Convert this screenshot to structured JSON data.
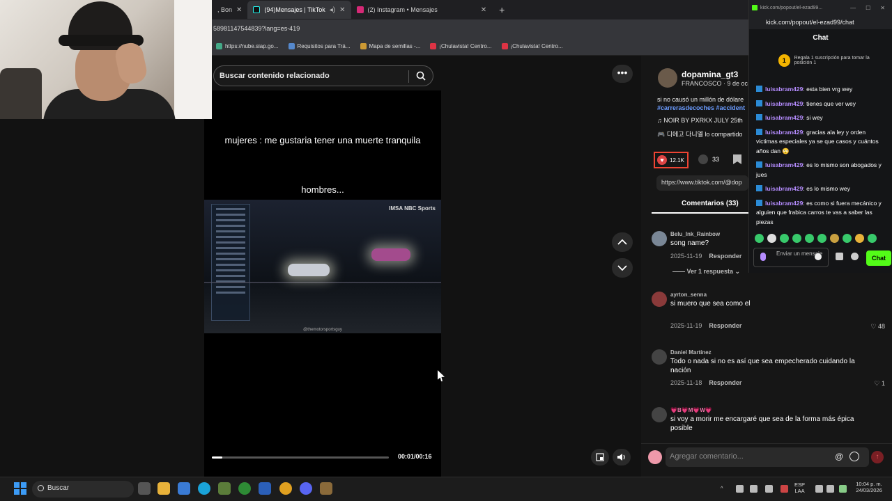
{
  "browser": {
    "tabs": [
      {
        "label": ", Bon",
        "icon": "tab-icon"
      },
      {
        "label": "(94)Mensajes | TikTok",
        "icon": "tiktok-icon"
      },
      {
        "label": "(2) Instagram • Mensajes",
        "icon": "instagram-icon"
      }
    ],
    "url": "58981147544839?lang=es-419",
    "bookmarks": [
      "https://nube.siap.go...",
      "Requisitos para Trá...",
      "Mapa de semillas -...",
      "¡Chulavista! Centro...",
      "¡Chulavista! Centro..."
    ]
  },
  "search": {
    "placeholder": "Buscar contenido relacionado"
  },
  "video": {
    "caption_top": "mujeres : me gustaria tener una muerte tranquila",
    "caption_mid": "hombres...",
    "clip_logo": "IMSA  NBC Sports",
    "clip_watermark": "@themotorsportsguy",
    "time": "00:01/00:16",
    "progress": 0.03
  },
  "post": {
    "author": "dopamina_gt3",
    "author_sub": "FRANCOSCO · 9 de oc",
    "description": "si no causó un millón de dólare",
    "tags": "#carrerasdecoches #accident",
    "music": "♫  NOIR BY PXRKX JULY 25th",
    "effect": "🎮 디에고 다니엘 lo compartido",
    "likes": "12.1K",
    "comments": "33",
    "link": "https://www.tiktok.com/@dop",
    "comments_tab": "Comentarios (33)"
  },
  "comments": [
    {
      "user": "Belu_Ink_Rainbow",
      "text": "song name?",
      "date": "2025-11-19",
      "reply": "Responder",
      "likes": "",
      "replies": "Ver 1 respuesta ⌄"
    },
    {
      "user": "ayrton_senna",
      "text": "si muero que sea como el",
      "date": "2025-11-19",
      "reply": "Responder",
      "likes": "♡ 48",
      "replies": ""
    },
    {
      "user": "Daniel Martínez",
      "text": "Todo o nada si no es así que sea empecherado cuidando la nación",
      "date": "2025-11-18",
      "reply": "Responder",
      "likes": "♡ 1",
      "replies": ""
    },
    {
      "user": "💗B💗M💗W💗",
      "text": "si voy a morir me encargaré que sea de la forma más épica posible",
      "date": "",
      "reply": "",
      "likes": "",
      "replies": ""
    }
  ],
  "comment_input": {
    "placeholder": "Agregar comentario...",
    "at": "@",
    "send": "↑"
  },
  "kick": {
    "titlebar": "kick.com/popout/el-ezad99...",
    "url": "kick.com/popout/el-ezad99/chat",
    "header": "Chat",
    "promo_badge": "1",
    "promo_text": "Regala 1 suscripción para tomar la posición 1",
    "messages": [
      {
        "user": "luisabram429",
        "text": ": esta bien vrg wey"
      },
      {
        "user": "luisabram429",
        "text": ": tienes que ver wey"
      },
      {
        "user": "luisabram429",
        "text": ": si wey"
      },
      {
        "user": "luisabram429",
        "text": ": gracias ala ley y orden victimas especiales ya se que casos y cuántos años dan 😳"
      },
      {
        "user": "luisabram429",
        "text": ": es lo mismo son abogados y jues"
      },
      {
        "user": "luisabram429",
        "text": ": es lo mismo wey"
      },
      {
        "user": "luisabram429",
        "text": ": es como si fuera mecánico y alguien que frabica carros te vas a saber las piezas"
      }
    ],
    "input_placeholder": "Enviar un mensaje",
    "send_label": "Chat"
  },
  "taskbar": {
    "search_label": "Buscar",
    "lang": "ESP\nLAA",
    "time": "10:04 p. m.",
    "date": "24/03/2026"
  }
}
